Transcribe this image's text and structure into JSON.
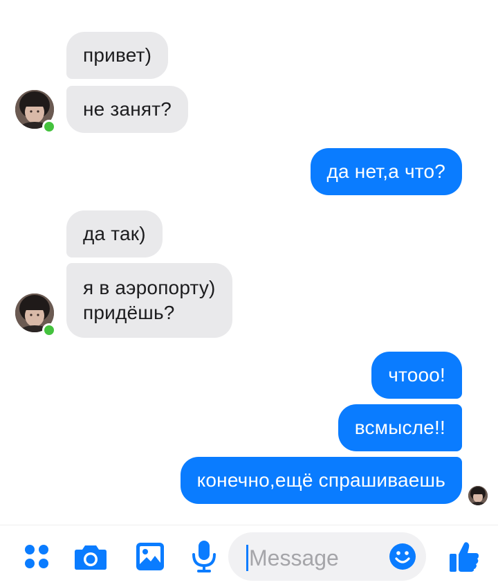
{
  "messages": [
    {
      "side": "in",
      "text": "привет)"
    },
    {
      "side": "in",
      "text": "не занят?"
    },
    {
      "side": "out",
      "text": "да нет,а что?"
    },
    {
      "side": "in",
      "text": "да так)"
    },
    {
      "side": "in",
      "text": "я в аэропорту)",
      "text2": "придёшь?"
    },
    {
      "side": "out",
      "text": "чтооо!"
    },
    {
      "side": "out",
      "text": "всмысле!!"
    },
    {
      "side": "out",
      "text": "конечно,ещё спрашиваешь"
    }
  ],
  "composer": {
    "placeholder": "Message",
    "icons": [
      "apps-icon",
      "camera-icon",
      "gallery-icon",
      "microphone-icon",
      "emoji-icon",
      "thumbs-up-icon"
    ]
  },
  "colors": {
    "accent": "#0a7cff",
    "incoming_bubble": "#e9e9eb",
    "online": "#44c23e"
  }
}
